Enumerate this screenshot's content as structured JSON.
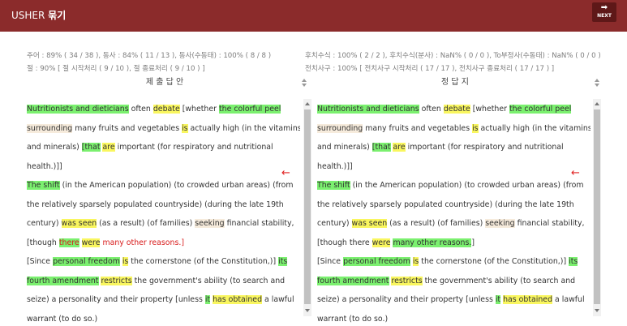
{
  "header": {
    "brand_plain": "USHER ",
    "brand_bold": "묶기",
    "next_icon": "➡",
    "next_label": "NEXT"
  },
  "stats": {
    "left_line1": "주어 : 89% ( 34 / 38 ), 동사 : 84% ( 11 / 13 ), 동사(수동태) : 100% ( 8 / 8 )",
    "left_line2": "절 : 90% [ 절 시작처리 ( 9 / 10 ), 절 종료처리 ( 9 / 10 ) ]",
    "right_line1": "후치수식 : 100% ( 2 / 2 ), 후치수식(분사) : NaN% ( 0 / 0 ), To부정사(수동태) : NaN% ( 0 / 0 )",
    "right_line2": "전치사구 : 100% [ 전치사구 시작처리 ( 17 / 17 ), 전치사구 종료처리 ( 17 / 17 ) ]"
  },
  "panes": {
    "left_title": "제 출 답 안",
    "right_title": "정 답 지",
    "arrow_glyph": "←"
  },
  "left_text": {
    "l1": [
      "Nutritionists and dieticians",
      " often ",
      "debate",
      " [whether ",
      "the colorful peel"
    ],
    "l2": [
      "surrounding",
      " many fruits and vegetables ",
      "is",
      " actually high (in the vitamins"
    ],
    "l3": [
      "and minerals) ",
      "[that",
      " ",
      "are",
      " important (for respiratory and nutritional"
    ],
    "l4": [
      "health.)]]"
    ],
    "l5": [
      "The shift",
      " (in the American population) (to crowded urban areas) (from"
    ],
    "l6": [
      "the relatively sparsely populated countryside) (during the late 19th"
    ],
    "l7": [
      "century) ",
      "was seen",
      " (as a result) (of families) ",
      "seeking",
      " financial stability,"
    ],
    "l8": [
      "[though ",
      "there",
      " ",
      "were",
      " many other reasons.]"
    ],
    "l9": [
      "[Since ",
      "personal freedom",
      " ",
      "is",
      " the cornerstone (of the Constitution,)] ",
      "its"
    ],
    "l10": [
      "fourth amendment",
      " ",
      "restricts",
      " the government's ability (to search and"
    ],
    "l11": [
      "seize) a personality and their property [unless ",
      "it",
      " ",
      "has obtained",
      " a lawful"
    ],
    "l12": [
      "warrant (to do so.)"
    ]
  },
  "right_text": {
    "l1": [
      "Nutritionists and dieticians",
      " often ",
      "debate",
      " [whether ",
      "the colorful peel"
    ],
    "l2": [
      "surrounding",
      " many fruits and vegetables ",
      "is",
      " actually high (in the vitamins"
    ],
    "l3": [
      "and minerals) ",
      "[that",
      " ",
      "are",
      " important (for respiratory and nutritional"
    ],
    "l4": [
      "health.)]]"
    ],
    "l5": [
      "The shift",
      " (in the American population) (to crowded urban areas) (from"
    ],
    "l6": [
      "the relatively sparsely populated countryside) (during the late 19th"
    ],
    "l7": [
      "century) ",
      "was seen",
      " (as a result) (of families) ",
      "seeking",
      " financial stability,"
    ],
    "l8": [
      "[though there ",
      "were",
      " ",
      "many other reasons.",
      "]"
    ],
    "l9": [
      "[Since ",
      "personal freedom",
      " ",
      "is",
      " the cornerstone (of the Constitution,)] ",
      "its"
    ],
    "l10": [
      "fourth amendment",
      " ",
      "restricts",
      " the government's ability (to search and"
    ],
    "l11": [
      "seize) a personality and their property [unless ",
      "it",
      " ",
      "has obtained",
      " a lawful"
    ],
    "l12": [
      "warrant (to do so.)"
    ]
  },
  "colors": {
    "header_bg": "#8b2b2b",
    "highlight_subject": "#7bf06f",
    "highlight_verb": "#f9f65f",
    "highlight_modifier": "#f6ebdc",
    "error_red": "#d81b1b"
  }
}
